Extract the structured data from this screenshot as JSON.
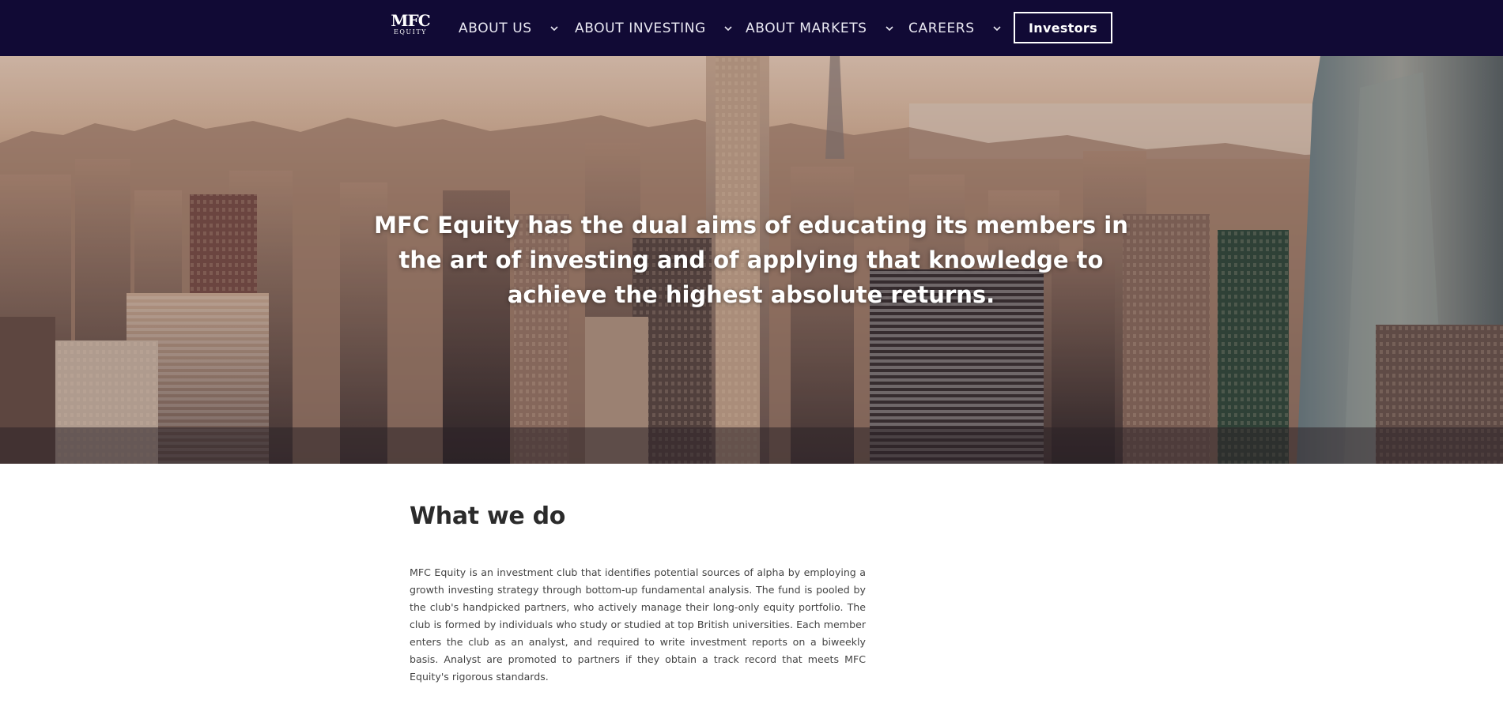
{
  "nav": {
    "logo": {
      "line1": "MFC",
      "line2": "EQUITY"
    },
    "items": [
      {
        "label": "ABOUT US"
      },
      {
        "label": "ABOUT INVESTING"
      },
      {
        "label": "ABOUT MARKETS"
      },
      {
        "label": "CAREERS"
      }
    ],
    "investors_label": "Investors",
    "background_color": "#110a35"
  },
  "hero": {
    "headline": "MFC Equity has the dual aims of educating its members in the art of investing and of applying that knowledge to achieve the highest absolute returns."
  },
  "about": {
    "title": "What we do",
    "body": "MFC Equity is an investment club that identifies potential sources of alpha by employing a growth investing strategy through bottom-up fundamental analysis. The fund is pooled by the club's handpicked partners, who actively manage their long-only equity portfolio. The club is formed by individuals who study or studied at top British universities. Each member enters the club as an analyst, and required to write investment reports on a biweekly basis. Analyst are promoted to partners if they obtain a track record that meets MFC Equity's rigorous standards."
  }
}
